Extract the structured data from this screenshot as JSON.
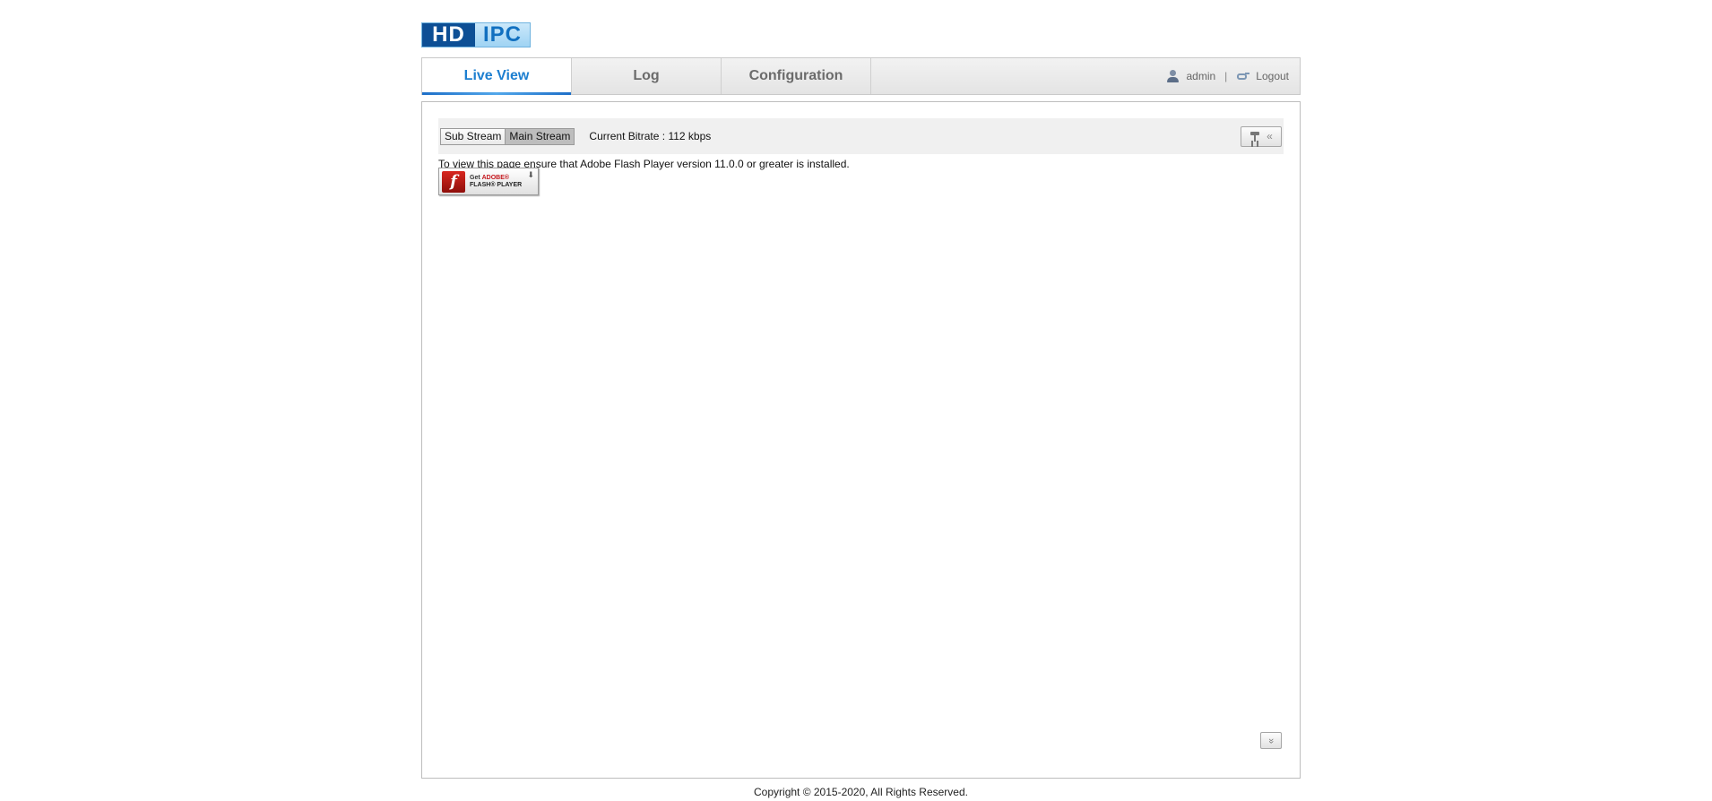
{
  "logo": {
    "left_text": "HD",
    "right_text": "IPC"
  },
  "nav": {
    "tabs": [
      {
        "label": "Live View",
        "active": true
      },
      {
        "label": "Log",
        "active": false
      },
      {
        "label": "Configuration",
        "active": false
      }
    ],
    "user": {
      "icon": "user-icon",
      "name": "admin",
      "separator": "|",
      "logout_icon": "logout-icon",
      "logout_label": "Logout"
    },
    "accent_color": "#1d7fd0"
  },
  "toolbar": {
    "sub_stream_label": "Sub Stream",
    "main_stream_label": "Main Stream",
    "selected_stream": "Main Stream",
    "bitrate_text": "Current Bitrate : 112 kbps",
    "ptz_toggle_icon": "ptz-camera-icon",
    "ptz_toggle_arrow": "«"
  },
  "content": {
    "flash_notice": "To view this page ensure that Adobe Flash Player version 11.0.0 or greater is installed.",
    "flash_badge": {
      "logo_letter": "f",
      "line1_prefix": "Get ",
      "line1_brand": "ADOBE®",
      "line2": "FLASH® PLAYER",
      "icon": "download-arrow-icon",
      "arrow": "🠗"
    },
    "collapse_arrow": "»"
  },
  "footer": {
    "copyright": "Copyright © 2015-2020, All Rights Reserved."
  }
}
